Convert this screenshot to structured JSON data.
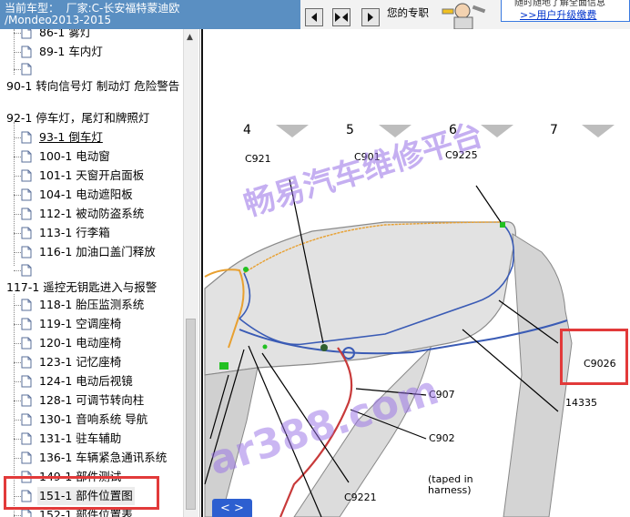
{
  "topbar": {
    "car_info": "当前车型：  厂家:C-长安福特蒙迪欧\n/Mondeo2013-2015",
    "notice": "您的专职",
    "upgrade_top": "随时随地了解全面信息",
    "upgrade_link": ">>用户升级缴费",
    "nav_buttons": [
      "prev-page",
      "fit-page",
      "next-page"
    ]
  },
  "tree": {
    "items": [
      {
        "label": "86-1 雾灯",
        "type": "doc"
      },
      {
        "label": "89-1 车内灯",
        "type": "doc"
      },
      {
        "label": "",
        "type": "doc"
      },
      {
        "label": "90-1 转向信号灯 制动灯 危险警告",
        "type": "folder"
      },
      {
        "label": "92-1 停车灯，尾灯和牌照灯",
        "type": "folder"
      },
      {
        "label": "93-1 倒车灯",
        "type": "doc",
        "current": true
      },
      {
        "label": "100-1 电动窗",
        "type": "doc"
      },
      {
        "label": "101-1 天窗开启面板",
        "type": "doc"
      },
      {
        "label": "104-1 电动遮阳板",
        "type": "doc"
      },
      {
        "label": "112-1 被动防盗系统",
        "type": "doc"
      },
      {
        "label": "113-1 行李箱",
        "type": "doc"
      },
      {
        "label": "116-1 加油口盖门释放",
        "type": "doc"
      },
      {
        "label": "",
        "type": "doc"
      },
      {
        "label": "117-1 遥控无钥匙进入与报警",
        "type": "folder"
      },
      {
        "label": "118-1 胎压监测系统",
        "type": "doc"
      },
      {
        "label": "119-1 空调座椅",
        "type": "doc"
      },
      {
        "label": "120-1 电动座椅",
        "type": "doc"
      },
      {
        "label": "123-1 记忆座椅",
        "type": "doc"
      },
      {
        "label": "124-1 电动后视镜",
        "type": "doc"
      },
      {
        "label": "128-1 可调节转向柱",
        "type": "doc"
      },
      {
        "label": "130-1 音响系统 导航",
        "type": "doc"
      },
      {
        "label": "131-1 驻车辅助",
        "type": "doc"
      },
      {
        "label": "136-1 车辆紧急通讯系统",
        "type": "doc"
      },
      {
        "label": "149-1 部件测试",
        "type": "doc"
      },
      {
        "label": "151-1 部件位置图",
        "type": "doc",
        "selected": true
      },
      {
        "label": "152-1 部件位置表",
        "type": "doc"
      }
    ]
  },
  "diagram": {
    "columns": [
      "4",
      "5",
      "6",
      "7"
    ],
    "connectors": [
      "C921",
      "C901",
      "C9225",
      "C9026",
      "C907",
      "C902",
      "14335",
      "C9221",
      "(taped in",
      "harness)"
    ],
    "watermark_main": "畅易汽车维修平台",
    "watermark_site": "ar388.com",
    "pager": "< >",
    "colors": {
      "highlight": "#e23a3a",
      "roof": "#d9d9d9",
      "blue_wire": "#3a5bb5",
      "red_wire": "#c83a3a",
      "orange_wire": "#e8a030"
    }
  }
}
